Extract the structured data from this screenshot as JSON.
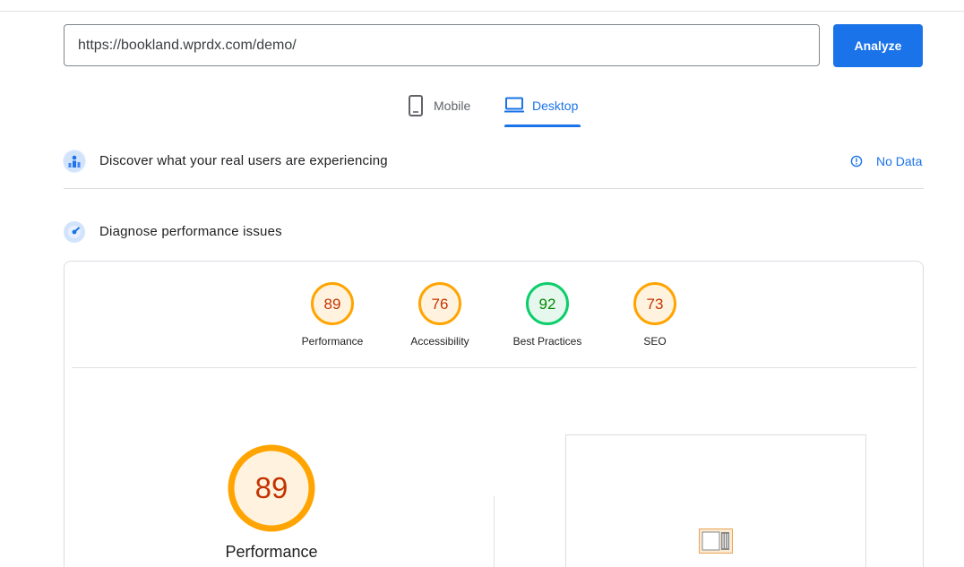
{
  "search": {
    "url_value": "https://bookland.wprdx.com/demo/",
    "analyze_label": "Analyze"
  },
  "device_tabs": [
    {
      "label": "Mobile",
      "icon": "mobile-phone-icon",
      "selected": false
    },
    {
      "label": "Desktop",
      "icon": "laptop-icon",
      "selected": true
    }
  ],
  "field_data": {
    "title": "Discover what your real users are experiencing",
    "icon": "users-chart-icon",
    "status_icon": "info-icon",
    "status_label": "No Data"
  },
  "lab_data": {
    "title": "Diagnose performance issues",
    "icon": "speedometer-icon"
  },
  "scores": [
    {
      "label": "Performance",
      "value": "89",
      "color": "#ffa400",
      "text_color": "#c33300",
      "fill": "#fff3e0"
    },
    {
      "label": "Accessibility",
      "value": "76",
      "color": "#ffa400",
      "text_color": "#c33300",
      "fill": "#fff3e0"
    },
    {
      "label": "Best Practices",
      "value": "92",
      "color": "#0cce6b",
      "text_color": "#008800",
      "fill": "#e6f8ee"
    },
    {
      "label": "SEO",
      "value": "73",
      "color": "#ffa400",
      "text_color": "#c33300",
      "fill": "#fff3e0"
    }
  ],
  "performance_detail": {
    "score": "89",
    "title": "Performance",
    "thumbnail_icon": "page-thumbnail-icon"
  },
  "colors": {
    "accent": "#1a73e8",
    "average": "#ffa400",
    "pass": "#0cce6b"
  }
}
